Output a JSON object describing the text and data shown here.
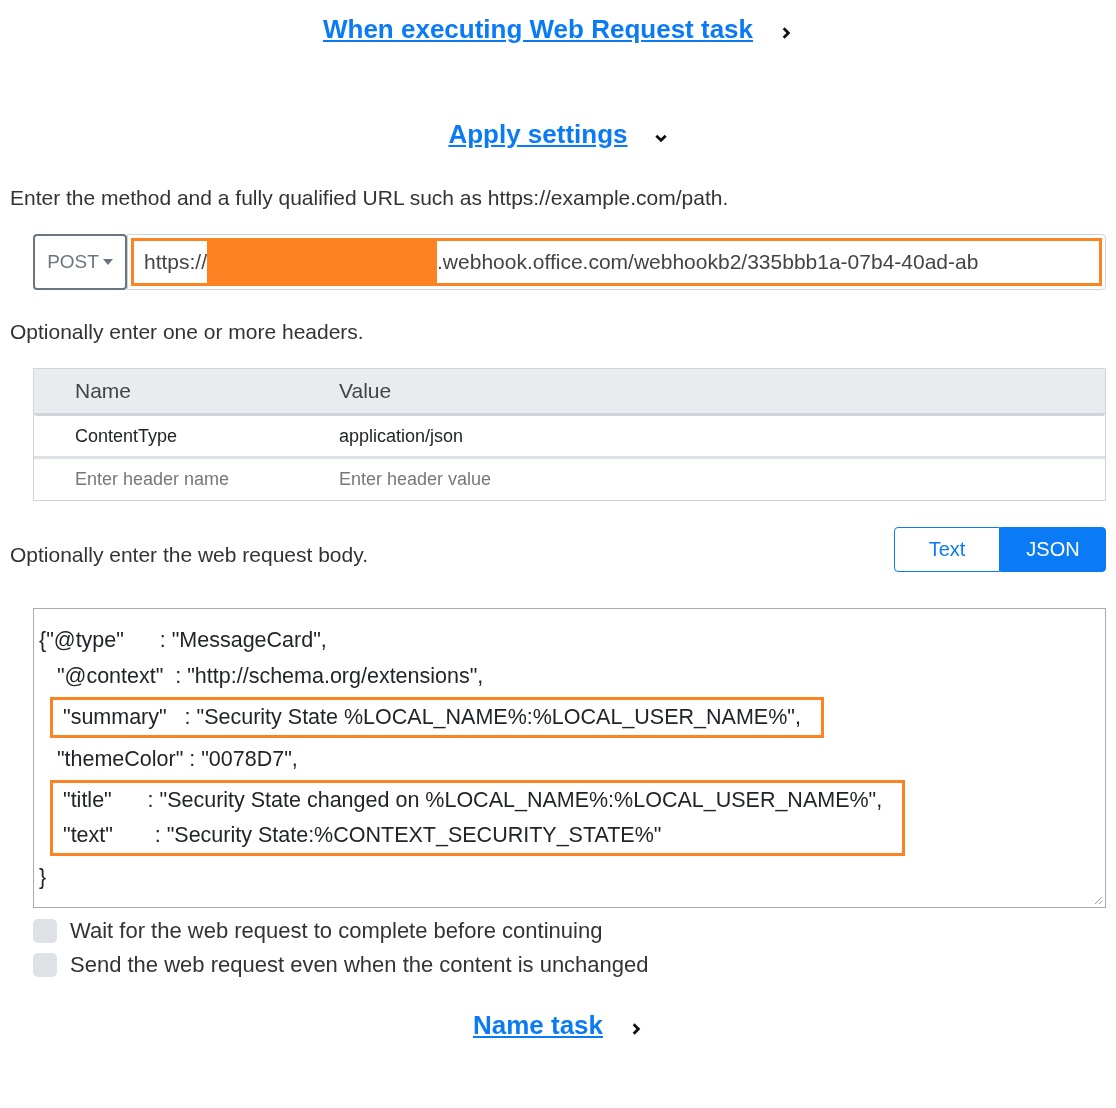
{
  "sections_before": [
    {
      "title": "When executing Web Request task",
      "expanded": false
    },
    {
      "title": "Apply settings",
      "expanded": true
    }
  ],
  "url_prompt": "Enter the method and a fully qualified URL such as https://example.com/path.",
  "method": {
    "label": "POST"
  },
  "url": {
    "start": "https://",
    "end": ".webhook.office.com/webhookb2/335bbb1a-07b4-40ad-ab",
    "redacted": true,
    "highlighted": true
  },
  "headers_prompt": "Optionally enter one or more headers.",
  "headers": {
    "columns": [
      "Name",
      "Value"
    ],
    "rows": [
      [
        "ContentType",
        "application/json"
      ]
    ],
    "new_row": {
      "name_placeholder": "Enter header name",
      "value_placeholder": "Enter header value"
    }
  },
  "body_prompt": "Optionally enter the web request body.",
  "body_format": [
    {
      "label": "Text",
      "selected": false
    },
    {
      "label": "JSON",
      "selected": true
    }
  ],
  "body": {
    "blocks": [
      {
        "highlighted": false,
        "lines": [
          "{\"@type\"      : \"MessageCard\",",
          "   \"@context\"  : \"http://schema.org/extensions\","
        ]
      },
      {
        "highlighted": true,
        "lines": [
          "\"summary\"   : \"Security State %LOCAL_NAME%:%LOCAL_USER_NAME%\","
        ]
      },
      {
        "highlighted": false,
        "lines": [
          "   \"themeColor\" : \"0078D7\","
        ]
      },
      {
        "highlighted": true,
        "lines": [
          "\"title\"      : \"Security State changed on %LOCAL_NAME%:%LOCAL_USER_NAME%\",",
          "\"text\"       : \"Security State:%CONTEXT_SECURITY_STATE%\""
        ]
      },
      {
        "highlighted": false,
        "lines": [
          "}"
        ]
      }
    ]
  },
  "options": [
    {
      "label": "Wait for the web request to complete before continuing",
      "checked": false
    },
    {
      "label": "Send the web request even when the content is unchanged",
      "checked": false
    }
  ],
  "sections_after": [
    {
      "title": "Name task",
      "expanded": false
    }
  ]
}
